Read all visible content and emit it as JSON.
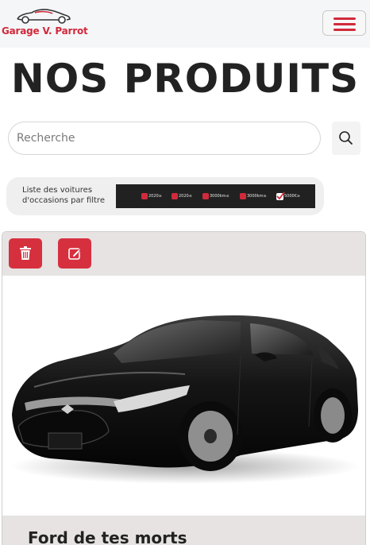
{
  "brand": {
    "name": "Garage V. Parrot",
    "logo_icon": "car-logo-icon",
    "accent": "#d12a3b"
  },
  "navbar": {
    "menu_icon": "hamburger-menu-icon"
  },
  "page": {
    "title": "NOS PRODUITS"
  },
  "search": {
    "placeholder": "Recherche",
    "value": "",
    "icon": "search-icon"
  },
  "filters": {
    "label": "Liste des voitures d'occasions par filtre",
    "options": [
      {
        "text": "2020≥",
        "checked": false
      },
      {
        "text": "2020≤",
        "checked": false
      },
      {
        "text": "3000km≤",
        "checked": false
      },
      {
        "text": "3000km≥",
        "checked": false
      },
      {
        "text": "5000€≥",
        "checked": true
      }
    ]
  },
  "products": [
    {
      "title": "Ford de tes morts",
      "delete_icon": "trash-icon",
      "edit_icon": "edit-icon",
      "image": "black-sedan-car-photo"
    }
  ]
}
